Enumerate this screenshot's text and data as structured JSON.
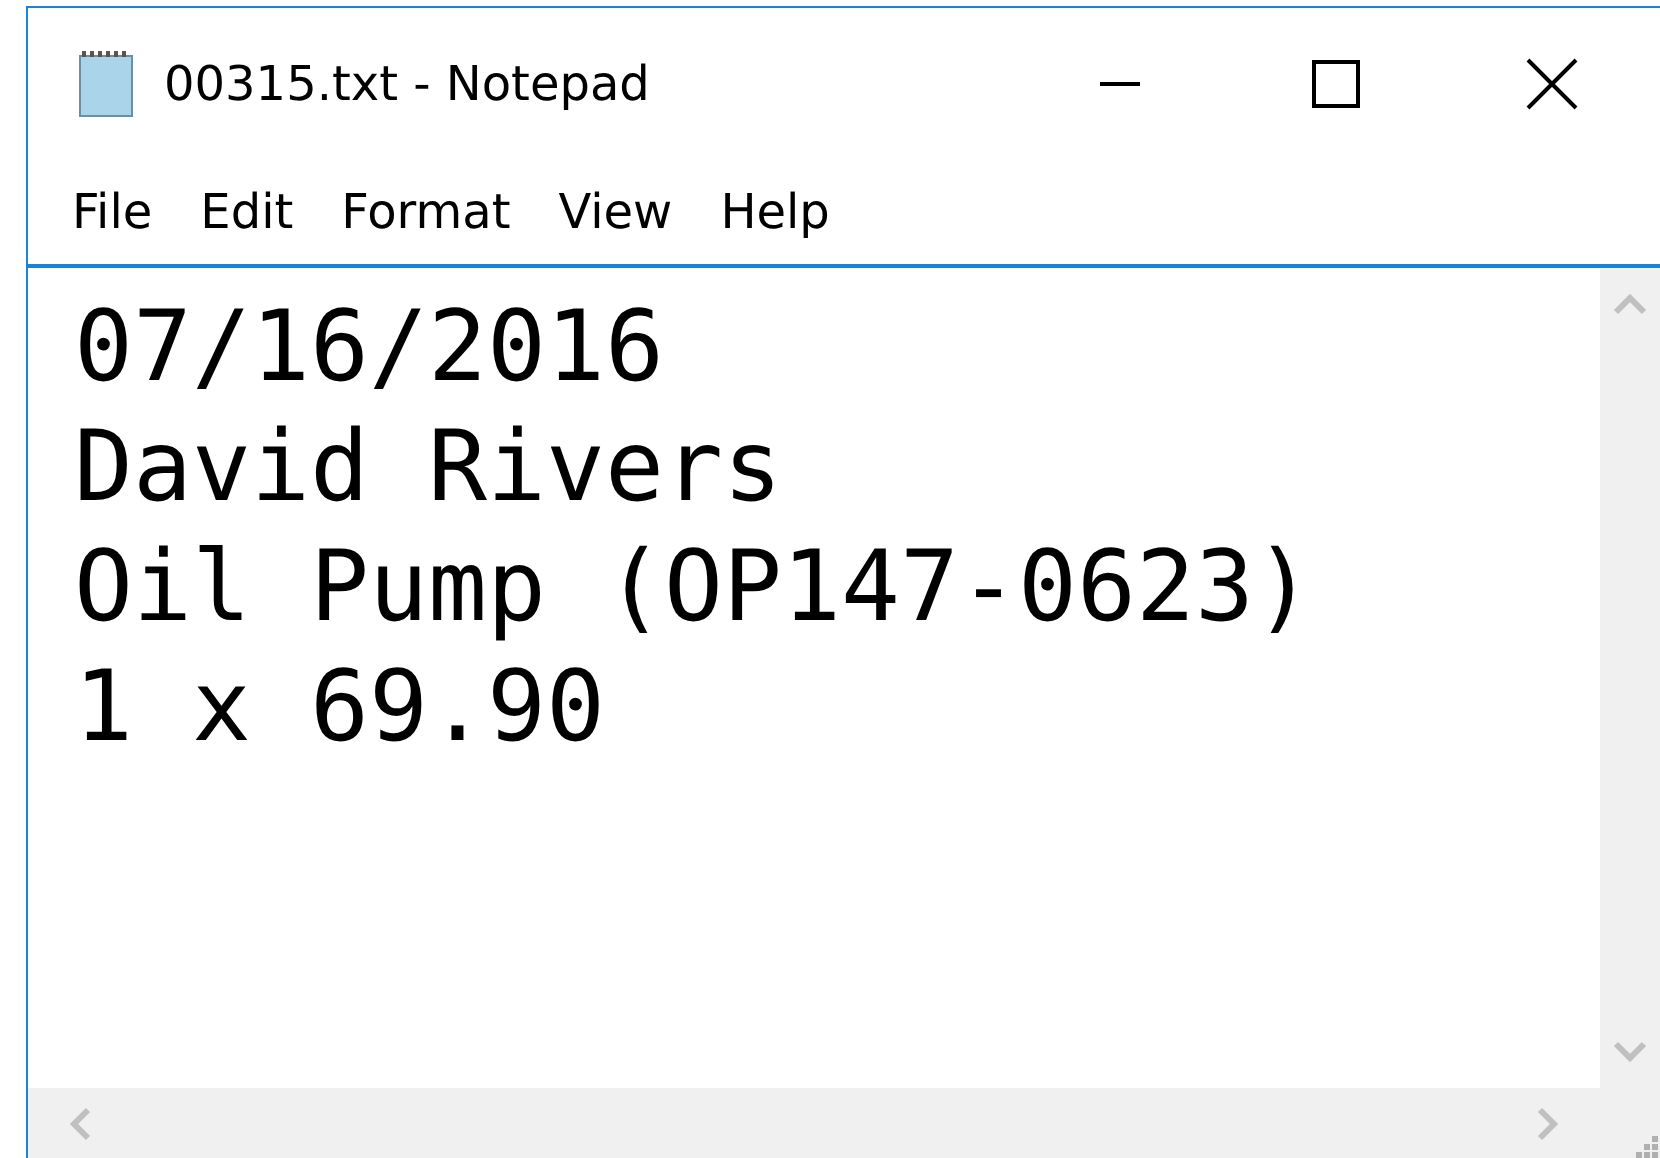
{
  "window": {
    "title": "00315.txt - Notepad"
  },
  "menu": [
    "File",
    "Edit",
    "Format",
    "View",
    "Help"
  ],
  "document": {
    "lines": [
      "07/16/2016",
      "David Rivers",
      "Oil Pump (OP147-0623)",
      "1 x 69.90"
    ]
  }
}
